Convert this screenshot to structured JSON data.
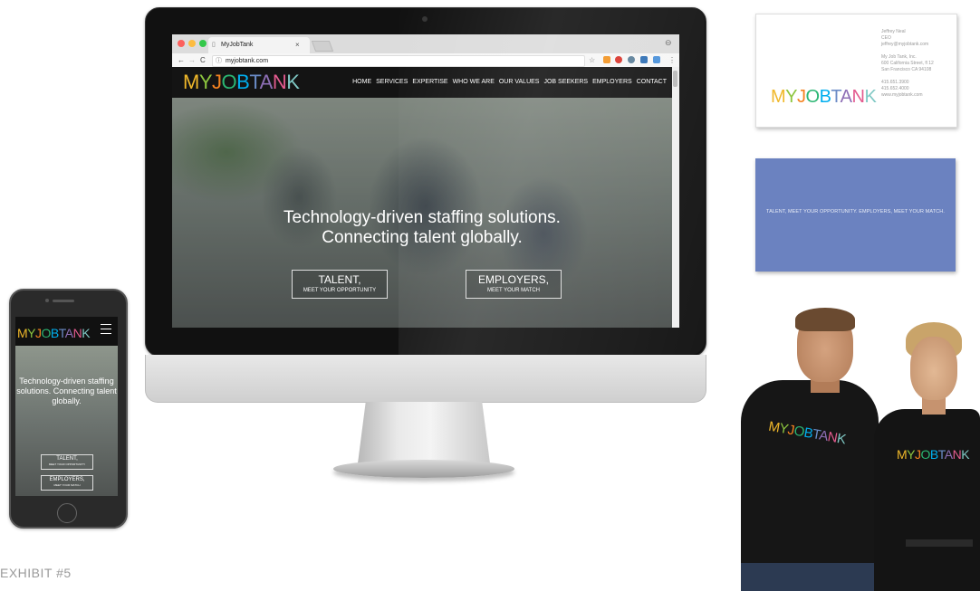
{
  "brand": {
    "logo_letters": [
      "M",
      "Y",
      "J",
      "O",
      "B",
      "T",
      "A",
      "N",
      "K"
    ]
  },
  "browser": {
    "tab_title": "MyJobTank",
    "tab_close": "×",
    "url": "myjobtank.com",
    "nav_back": "←",
    "nav_forward": "→",
    "nav_reload": "C",
    "url_info": "ⓘ",
    "account_icon": "⊖",
    "menu_icon": "⋮"
  },
  "site": {
    "nav_items": [
      "HOME",
      "SERVICES",
      "EXPERTISE",
      "WHO WE ARE",
      "OUR VALUES",
      "JOB SEEKERS",
      "EMPLOYERS",
      "CONTACT"
    ],
    "hero_line1": "Technology-driven staffing solutions.",
    "hero_line2": "Connecting talent globally.",
    "talent_big": "TALENT,",
    "talent_small": "MEET YOUR OPPORTUNITY",
    "employers_big": "EMPLOYERS,",
    "employers_small": "MEET YOUR MATCH"
  },
  "phone": {
    "hero_text": "Technology-driven staffing solutions. Connecting talent globally.",
    "talent_big": "TALENT,",
    "talent_small": "MEET YOUR OPPORTUNITY",
    "employers_big": "EMPLOYERS,",
    "employers_small": "MEET YOUR MATCH"
  },
  "card": {
    "name": "Jeffrey Neal",
    "title": "CEO",
    "email": "jeffrey@myjobtank.com",
    "company": "My Job Tank, Inc.",
    "address1": "600 California Street, fl 12",
    "address2": "San Francisco CA 94108",
    "phone1": "415.651.3900",
    "phone2": "415.652.4000",
    "website": "www.myjobtank.com",
    "back_tagline": "TALENT, MEET YOUR OPPORTUNITY.  EMPLOYERS, MEET YOUR MATCH."
  },
  "exhibit_label": "EXHIBIT #5",
  "colors": {
    "card_back": "#6b82c0",
    "site_nav": "#141414"
  }
}
